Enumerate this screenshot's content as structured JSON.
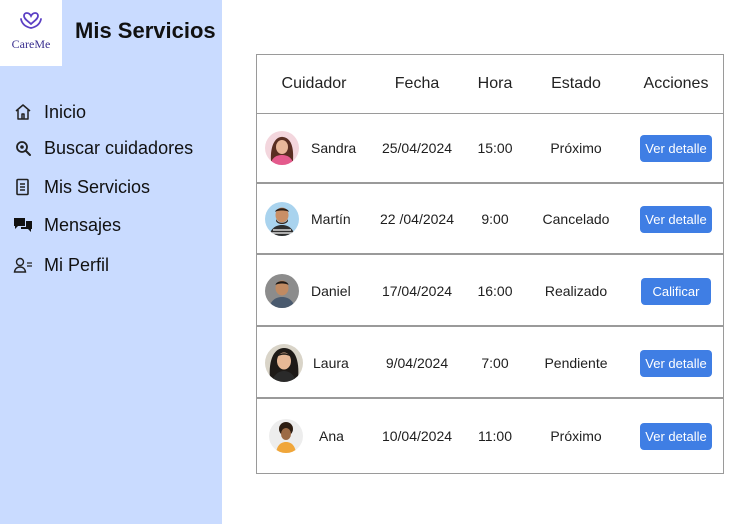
{
  "brand": {
    "logo_text": "CareMe"
  },
  "page_title": "Mis Servicios",
  "nav": [
    {
      "label": "Inicio",
      "icon": "home-icon"
    },
    {
      "label": "Buscar cuidadores",
      "icon": "search-icon"
    },
    {
      "label": "Mis Servicios",
      "icon": "document-icon"
    },
    {
      "label": "Mensajes",
      "icon": "chat-icon"
    },
    {
      "label": "Mi Perfil",
      "icon": "profile-icon"
    }
  ],
  "table": {
    "headers": [
      "Cuidador",
      "Fecha",
      "Hora",
      "Estado",
      "Acciones"
    ],
    "rows": [
      {
        "name": "Sandra",
        "date": "25/04/2024",
        "time": "15:00",
        "status": "Próximo",
        "action": "Ver detalle"
      },
      {
        "name": "Martín",
        "date": "22 /04/2024",
        "time": "9:00",
        "status": "Cancelado",
        "action": "Ver detalle"
      },
      {
        "name": "Daniel",
        "date": "17/04/2024",
        "time": "16:00",
        "status": "Realizado",
        "action": "Calificar"
      },
      {
        "name": "Laura",
        "date": "9/04/2024",
        "time": "7:00",
        "status": "Pendiente",
        "action": "Ver detalle"
      },
      {
        "name": "Ana",
        "date": "10/04/2024",
        "time": "11:00",
        "status": "Próximo",
        "action": "Ver detalle"
      }
    ]
  },
  "colors": {
    "sidebar_bg": "#c9dbff",
    "button_bg": "#3f7ee4",
    "logo_purple": "#3a2f8f"
  }
}
